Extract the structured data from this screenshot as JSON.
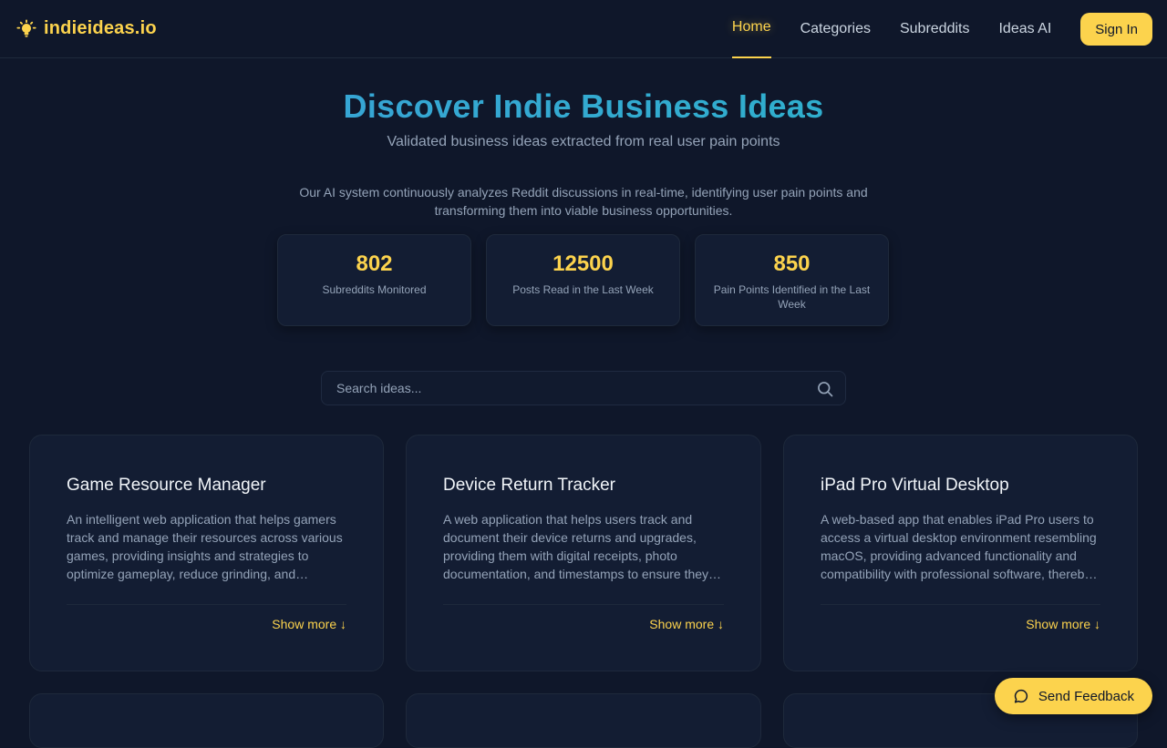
{
  "brand": {
    "name": "indieideas.io",
    "icon": "lightbulb-icon",
    "color": "#fcd34d"
  },
  "nav": {
    "items": [
      {
        "label": "Home",
        "active": true
      },
      {
        "label": "Categories",
        "active": false
      },
      {
        "label": "Subreddits",
        "active": false
      },
      {
        "label": "Ideas AI",
        "active": false
      }
    ],
    "signin_label": "Sign In"
  },
  "hero": {
    "title": "Discover Indie Business Ideas",
    "subtitle": "Validated business ideas extracted from real user pain points",
    "description": "Our AI system continuously analyzes Reddit discussions in real-time, identifying user pain points and transforming them into viable business opportunities."
  },
  "stats": [
    {
      "value": "802",
      "label": "Subreddits Monitored"
    },
    {
      "value": "12500",
      "label": "Posts Read in the Last Week"
    },
    {
      "value": "850",
      "label": "Pain Points Identified in the Last Week"
    }
  ],
  "search": {
    "placeholder": "Search ideas...",
    "value": "",
    "icon": "search-icon"
  },
  "ideas": [
    {
      "title": "Game Resource Manager",
      "description": "An intelligent web application that helps gamers track and manage their resources across various games, providing insights and strategies to optimize gameplay, reduce grinding, and…",
      "action": "Show more ↓"
    },
    {
      "title": "Device Return Tracker",
      "description": "A web application that helps users track and document their device returns and upgrades, providing them with digital receipts, photo documentation, and timestamps to ensure they…",
      "action": "Show more ↓"
    },
    {
      "title": "iPad Pro Virtual Desktop",
      "description": "A web-based app that enables iPad Pro users to access a virtual desktop environment resembling macOS, providing advanced functionality and compatibility with professional software, thereb…",
      "action": "Show more ↓"
    }
  ],
  "feedback": {
    "label": "Send Feedback",
    "icon": "chat-bubble-icon"
  },
  "colors": {
    "background": "#0f172a",
    "card": "#131d33",
    "accent": "#fcd34d",
    "title_gradient_start": "#3b9fd8",
    "title_gradient_end": "#2bb5c9"
  }
}
